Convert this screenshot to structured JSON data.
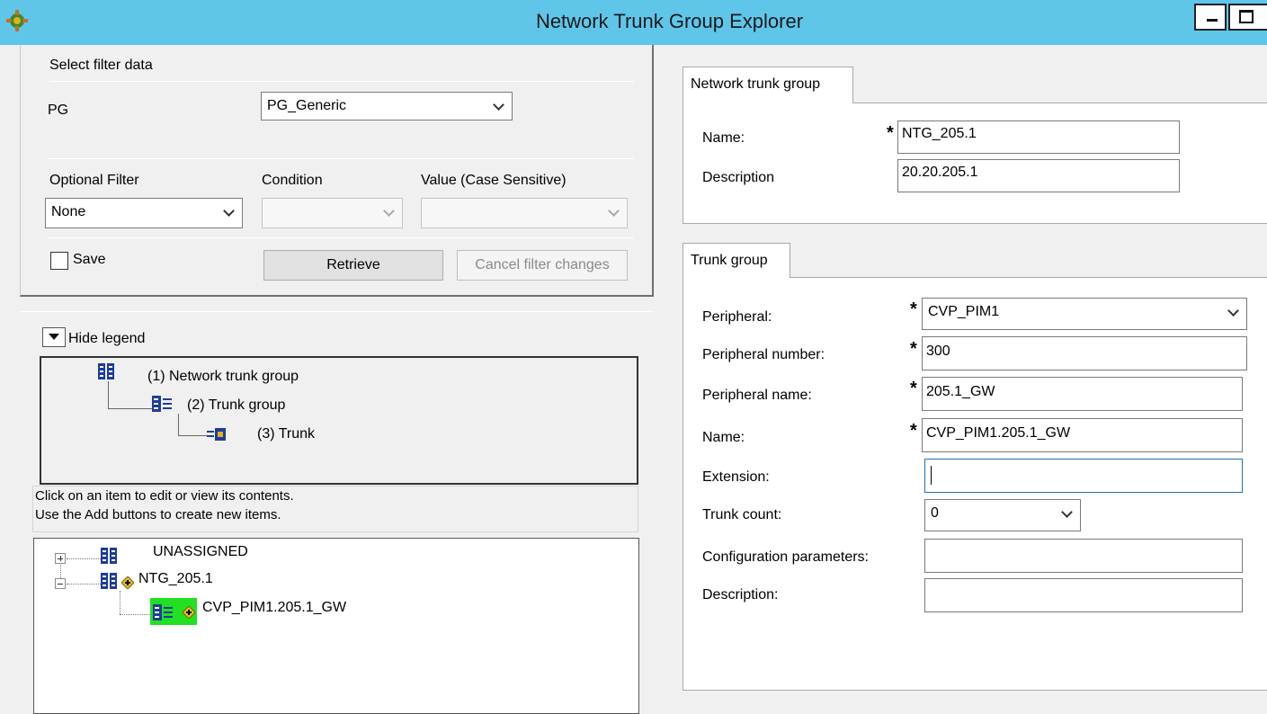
{
  "window": {
    "title": "Network Trunk Group Explorer"
  },
  "filter": {
    "group_label": "Select filter data",
    "pg_label": "PG",
    "pg_value": "PG_Generic",
    "optional_filter_label": "Optional Filter",
    "optional_filter_value": "None",
    "condition_label": "Condition",
    "condition_value": "",
    "value_label": "Value (Case Sensitive)",
    "value_value": "",
    "save_label": "Save",
    "save_checked": false,
    "retrieve_label": "Retrieve",
    "cancel_label": "Cancel filter changes"
  },
  "legend": {
    "toggle_label": "Hide legend",
    "items": [
      "(1) Network trunk group",
      "(2) Trunk group",
      "(3) Trunk"
    ]
  },
  "info": {
    "line1": "Click on an item to edit or view its contents.",
    "line2": "Use the Add buttons to create new items."
  },
  "tree": {
    "nodes": [
      {
        "label": "UNASSIGNED",
        "expanded": false
      },
      {
        "label": "NTG_205.1",
        "expanded": true
      },
      {
        "label": "CVP_PIM1.205.1_GW",
        "selected": true
      }
    ]
  },
  "network_trunk_group": {
    "tab_label": "Network trunk group",
    "name_label": "Name:",
    "name_value": "NTG_205.1",
    "description_label": "Description",
    "description_value": "20.20.205.1",
    "required_marker": "*"
  },
  "trunk_group": {
    "tab_label": "Trunk group",
    "peripheral_label": "Peripheral:",
    "peripheral_value": "CVP_PIM1",
    "peripheral_number_label": "Peripheral number:",
    "peripheral_number_value": "300",
    "peripheral_name_label": "Peripheral name:",
    "peripheral_name_value": "205.1_GW",
    "name_label": "Name:",
    "name_value": "CVP_PIM1.205.1_GW",
    "extension_label": "Extension:",
    "extension_value": "",
    "trunk_count_label": "Trunk count:",
    "trunk_count_value": "0",
    "config_params_label": "Configuration parameters:",
    "config_params_value": "",
    "description_label": "Description:",
    "description_value": "",
    "required_marker": "*"
  },
  "colors": {
    "titlebar": "#5fc6ea",
    "selection_highlight": "#22e022",
    "icon_blue": "#1e3c9a"
  }
}
